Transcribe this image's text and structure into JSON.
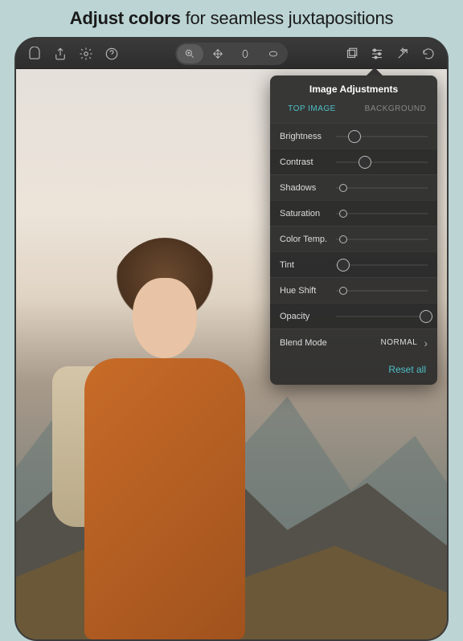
{
  "headline": {
    "bold": "Adjust colors",
    "rest": " for seamless juxtapositions"
  },
  "popover": {
    "title": "Image Adjustments",
    "tabs": {
      "top": "TOP IMAGE",
      "background": "BACKGROUND"
    },
    "sliders": {
      "brightness": {
        "label": "Brightness",
        "pos": 20
      },
      "contrast": {
        "label": "Contrast",
        "pos": 32
      },
      "shadows": {
        "label": "Shadows",
        "pos": 8
      },
      "saturation": {
        "label": "Saturation",
        "pos": 8
      },
      "colortemp": {
        "label": "Color Temp.",
        "pos": 8
      },
      "tint": {
        "label": "Tint",
        "pos": 8
      },
      "hueshift": {
        "label": "Hue Shift",
        "pos": 8
      },
      "opacity": {
        "label": "Opacity",
        "pos": 98
      }
    },
    "blend": {
      "label": "Blend Mode",
      "value": "NORMAL"
    },
    "reset": "Reset all"
  }
}
